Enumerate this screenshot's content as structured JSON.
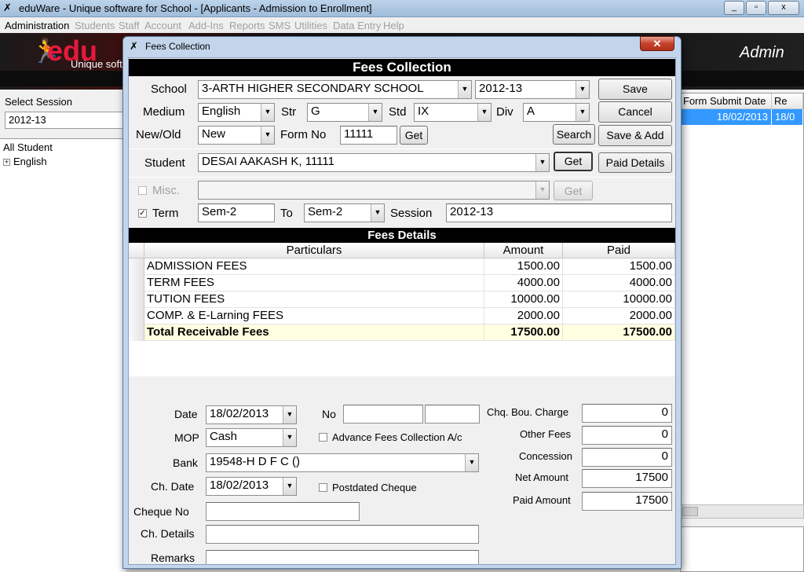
{
  "window": {
    "title": "eduWare - Unique software for School - [Applicants - Admission to Enrollment]",
    "caption_buttons": {
      "minimize": "_",
      "restore": "▫",
      "close": "x"
    }
  },
  "menu": [
    "Administration",
    "Students",
    "Staff",
    "Account",
    "Add-Ins",
    "Reports",
    "SMS",
    "Utilities",
    "Data Entry",
    "Help"
  ],
  "banner": {
    "logo": "edu",
    "tagline": "Unique soft",
    "user": "Admin"
  },
  "left": {
    "session_label": "Select Session",
    "session_value": "2012-13",
    "tree": {
      "root": "All Student",
      "child": "English"
    }
  },
  "right": {
    "headers": [
      "Form Submit Date",
      "Re"
    ],
    "row": [
      "18/02/2013",
      "18/0"
    ]
  },
  "dialog": {
    "title": "Fees Collection",
    "heading": "Fees Collection",
    "school_label": "School",
    "school_value": "3-ARTH HIGHER SECONDARY SCHOOL",
    "year_value": "2012-13",
    "medium_label": "Medium",
    "medium_value": "English",
    "str_label": "Str",
    "str_value": "G",
    "std_label": "Std",
    "std_value": "IX",
    "div_label": "Div",
    "div_value": "A",
    "newold_label": "New/Old",
    "newold_value": "New",
    "formno_label": "Form No",
    "formno_value": "11111",
    "get_label": "Get",
    "search_label": "Search",
    "save_label": "Save",
    "cancel_label": "Cancel",
    "saveadd_label": "Save & Add",
    "student_label": "Student",
    "student_value": "DESAI AAKASH K, 11111",
    "paid_details_label": "Paid Details",
    "misc_label": "Misc.",
    "term_label": "Term",
    "term_from": "Sem-2",
    "to_label": "To",
    "term_to": "Sem-2",
    "session_label": "Session",
    "session_value": "2012-13",
    "fees_heading": "Fees Details",
    "grid": {
      "headers": [
        "Particulars",
        "Amount",
        "Paid"
      ],
      "rows": [
        [
          "ADMISSION FEES",
          "1500.00",
          "1500.00"
        ],
        [
          "TERM FEES",
          "4000.00",
          "4000.00"
        ],
        [
          "TUTION FEES",
          "10000.00",
          "10000.00"
        ],
        [
          "COMP. & E-Larning FEES",
          "2000.00",
          "2000.00"
        ]
      ],
      "total": [
        "Total Receivable Fees",
        "17500.00",
        "17500.00"
      ]
    },
    "date_label": "Date",
    "date_value": "18/02/2013",
    "no_label": "No",
    "mop_label": "MOP",
    "mop_value": "Cash",
    "advance_label": "Advance Fees Collection A/c",
    "bank_label": "Bank",
    "bank_value": "19548-H D F C ()",
    "chdate_label": "Ch. Date",
    "chdate_value": "18/02/2013",
    "postdated_label": "Postdated Cheque",
    "chequeno_label": "Cheque No",
    "chdetails_label": "Ch. Details",
    "remarks_label": "Remarks",
    "chq_bou_label": "Chq. Bou. Charge",
    "chq_bou_value": "0",
    "other_fees_label": "Other Fees",
    "other_fees_value": "0",
    "concession_label": "Concession",
    "concession_value": "0",
    "net_amount_label": "Net Amount",
    "net_amount_value": "17500",
    "paid_amount_label": "Paid Amount",
    "paid_amount_value": "17500"
  }
}
